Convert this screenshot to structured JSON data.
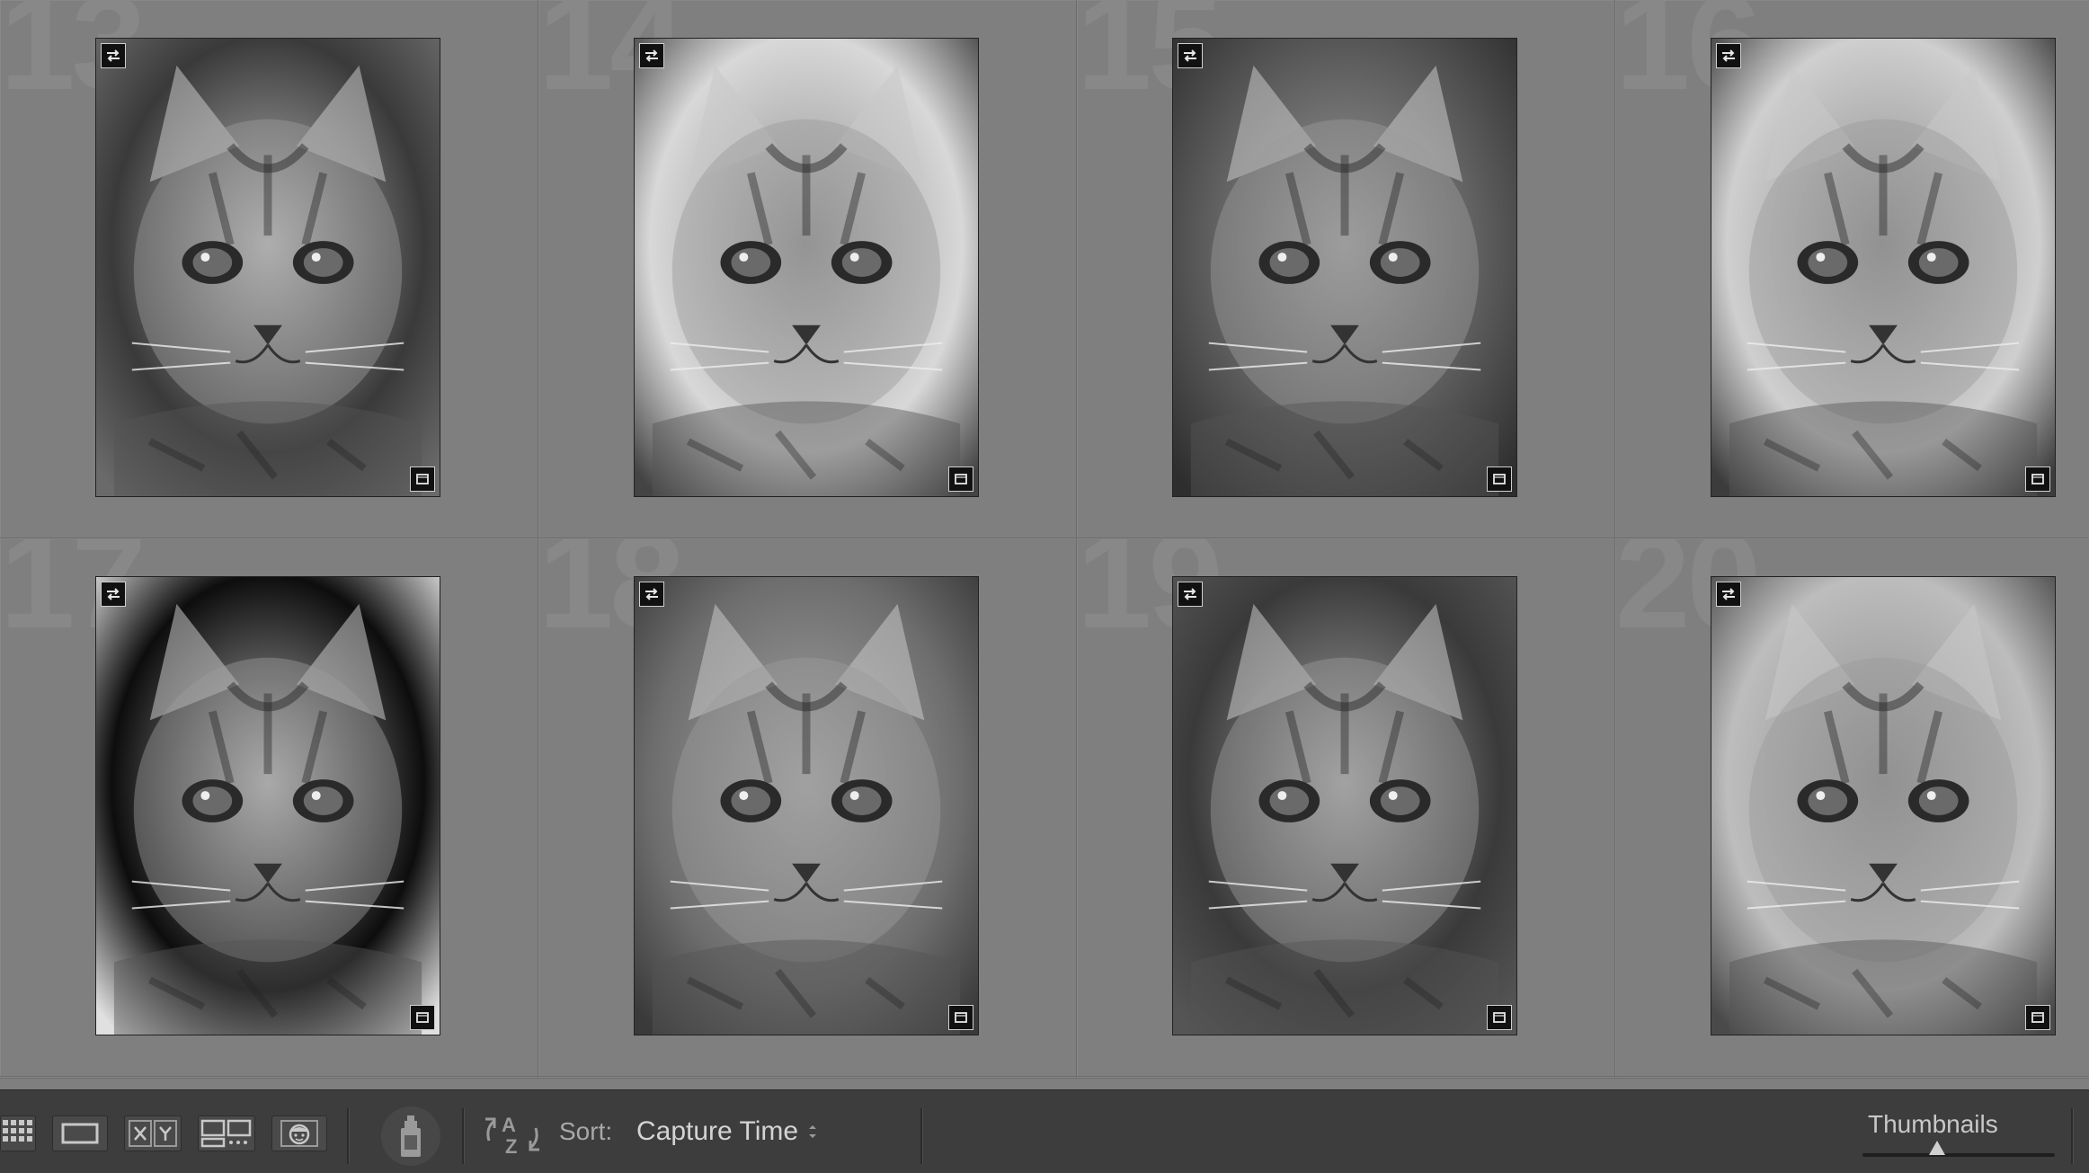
{
  "grid": {
    "cells": [
      {
        "number": "13",
        "selected": false
      },
      {
        "number": "14",
        "selected": false
      },
      {
        "number": "15",
        "selected": false
      },
      {
        "number": "16",
        "selected": false
      },
      {
        "number": "17",
        "selected": false
      },
      {
        "number": "18",
        "selected": false
      },
      {
        "number": "19",
        "selected": false
      },
      {
        "number": "20",
        "selected": false
      }
    ]
  },
  "toolbar": {
    "view_buttons": [
      {
        "name": "grid-view-icon"
      },
      {
        "name": "loupe-view-icon"
      },
      {
        "name": "compare-view-icon"
      },
      {
        "name": "survey-view-icon"
      },
      {
        "name": "people-view-icon"
      }
    ],
    "painter_icon": "spray-can-icon",
    "sort_direction_icon": "sort-az-icon",
    "sort_label": "Sort:",
    "sort_value": "Capture Time",
    "thumbnails_label": "Thumbnails",
    "thumbnail_size": 0.39
  },
  "colors": {
    "panel": "#7f7f7f",
    "toolbar": "#3d3d3d"
  }
}
